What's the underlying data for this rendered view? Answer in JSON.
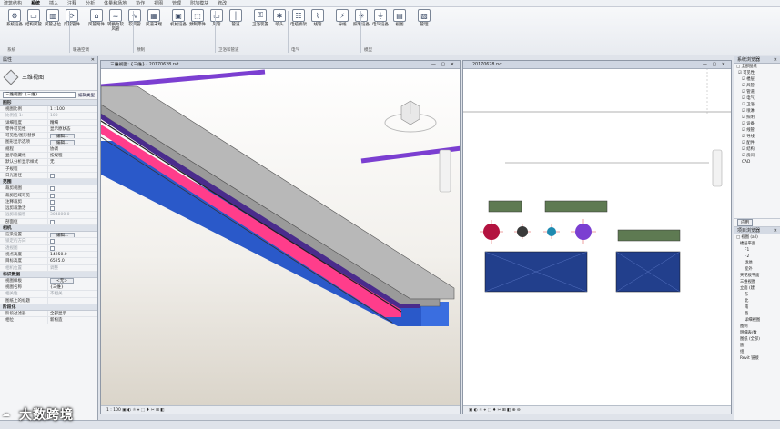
{
  "menu_tabs": [
    "建筑结构",
    "系统",
    "插入",
    "注释",
    "分析",
    "体量和场地",
    "协作",
    "视图",
    "管理",
    "附加模块",
    "修改"
  ],
  "ribbon": {
    "buttons": [
      "系统设备",
      "结构风管",
      "风管占位",
      "风管管件",
      "风管附件",
      "转换为软风管",
      "软风管",
      "风道末端",
      "机械设备",
      "预制零件",
      "风管",
      "管道",
      "卫浴装置",
      "喷头",
      "电缆桥架",
      "线管",
      "导线",
      "照明设备",
      "电气设备",
      "视图",
      "管理"
    ],
    "groups": [
      "系统",
      "暖通空调",
      "预制",
      "卫浴和管道",
      "电气",
      "模型"
    ]
  },
  "properties": {
    "title": "属性",
    "type_name": "三维视图",
    "selector_value": "三维视图: {三维}",
    "edit_type": "编辑类型",
    "sections": [
      {
        "name": "图形",
        "rows": [
          {
            "k": "视图比例",
            "v": "1 : 100",
            "kind": "text"
          },
          {
            "k": "比例值 1:",
            "v": "100",
            "kind": "text",
            "dim": true
          },
          {
            "k": "详细程度",
            "v": "精细",
            "kind": "text"
          },
          {
            "k": "零件可见性",
            "v": "显示原状态",
            "kind": "text"
          },
          {
            "k": "可见性/图形替换",
            "v": "编辑...",
            "kind": "button"
          },
          {
            "k": "图形显示选项",
            "v": "编辑...",
            "kind": "button"
          },
          {
            "k": "规程",
            "v": "协调",
            "kind": "text"
          },
          {
            "k": "显示隐藏线",
            "v": "按规程",
            "kind": "text"
          },
          {
            "k": "默认分析显示样式",
            "v": "无",
            "kind": "text"
          },
          {
            "k": "子规程",
            "v": "",
            "kind": "text"
          },
          {
            "k": "日光路径",
            "v": "",
            "kind": "check"
          }
        ]
      },
      {
        "name": "范围",
        "rows": [
          {
            "k": "裁剪视图",
            "v": "",
            "kind": "check"
          },
          {
            "k": "裁剪区域可见",
            "v": "",
            "kind": "check"
          },
          {
            "k": "注释裁剪",
            "v": "",
            "kind": "check"
          },
          {
            "k": "远剪裁激活",
            "v": "",
            "kind": "check"
          },
          {
            "k": "远剪裁偏移",
            "v": "304800.0",
            "kind": "text",
            "dim": true
          },
          {
            "k": "剖面框",
            "v": "",
            "kind": "check"
          }
        ]
      },
      {
        "name": "相机",
        "rows": [
          {
            "k": "渲染设置",
            "v": "编辑...",
            "kind": "button"
          },
          {
            "k": "锁定的方向",
            "v": "",
            "kind": "check",
            "dim": true
          },
          {
            "k": "透视图",
            "v": "",
            "kind": "check",
            "dim": true
          },
          {
            "k": "视点高度",
            "v": "14250.0",
            "kind": "text"
          },
          {
            "k": "目标高度",
            "v": "6525.0",
            "kind": "text"
          },
          {
            "k": "相机位置",
            "v": "调整",
            "kind": "text",
            "dim": true
          }
        ]
      },
      {
        "name": "标识数据",
        "rows": [
          {
            "k": "视图样板",
            "v": "<无>",
            "kind": "button"
          },
          {
            "k": "视图名称",
            "v": "{三维}",
            "kind": "text"
          },
          {
            "k": "相关性",
            "v": "不相关",
            "kind": "text",
            "dim": true
          },
          {
            "k": "图纸上的标题",
            "v": "",
            "kind": "text"
          }
        ]
      },
      {
        "name": "阶段化",
        "rows": [
          {
            "k": "阶段过滤器",
            "v": "全部显示",
            "kind": "text"
          },
          {
            "k": "相位",
            "v": "新构造",
            "kind": "text"
          }
        ]
      }
    ]
  },
  "view3d": {
    "title": "三维视图: {三维} - 20170628.rvt",
    "scale": "1 : 100"
  },
  "view2d": {
    "title": "20170628.rvt"
  },
  "browser": {
    "title": "系统浏览器",
    "tree": [
      "□ 全部图纸",
      "☑ 可见性",
      "☑ 楼层",
      "☑ 风管",
      "☑ 管道",
      "☑ 电气",
      "☑ 卫浴",
      "☑ 喷淋",
      "☑ 照明",
      "☑ 设备",
      "☑ 线管",
      "☑ 导线",
      "☑ 配件",
      "☑ 结构",
      "☑ 房间",
      "CAD"
    ],
    "apply_button": "应用",
    "project_title": "项目浏览器",
    "project_tree": [
      "□ 视图 (all)",
      "楼层平面",
      "F1",
      "F2",
      "场地",
      "室外",
      "天花板平面",
      "三维视图",
      "立面 (建",
      "东",
      "北",
      "南",
      "西",
      "详细视图",
      "图例",
      "明细表/数",
      "图纸 (全部)",
      "族",
      "组",
      "Revit 链接"
    ]
  },
  "watermark": {
    "text": "大数跨境"
  },
  "colors": {
    "accent_purple": "#7b3fd1",
    "pink_duct": "#ff3d8b",
    "blue_box": "#2a59c9",
    "dark_blue": "#223f8c",
    "olive": "#5e7a52",
    "red_circle": "#b3123f"
  }
}
